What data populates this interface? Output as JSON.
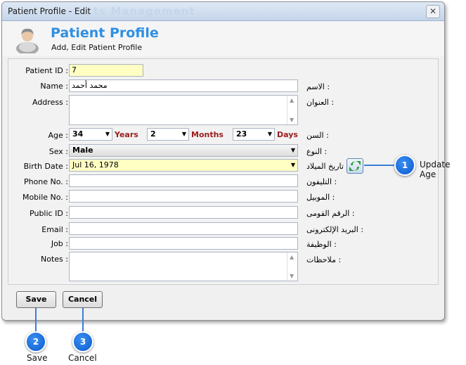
{
  "window": {
    "title": "Patient Profile - Edit",
    "ghost_text": "ts Management",
    "close_glyph": "✕"
  },
  "header": {
    "title": "Patient Profile",
    "subtitle": "Add, Edit Patient Profile",
    "avatar_icon": "patient-avatar-icon"
  },
  "form": {
    "patient_id": {
      "label": "Patient ID :",
      "value": "7"
    },
    "name": {
      "label": "Name :",
      "value": "محمد أحمد",
      "ar_label": "الاسم :"
    },
    "address": {
      "label": "Address :",
      "value": "",
      "ar_label": "العنوان :"
    },
    "age": {
      "label": "Age :",
      "ar_label": "السن :",
      "years_value": "34",
      "years_unit": "Years",
      "months_value": "2",
      "months_unit": "Months",
      "days_value": "23",
      "days_unit": "Days"
    },
    "sex": {
      "label": "Sex :",
      "value": "Male",
      "ar_label": "النوع :"
    },
    "birth_date": {
      "label": "Birth Date :",
      "value": "Jul 16, 1978",
      "ar_label": "تاريخ الميلاد :"
    },
    "phone": {
      "label": "Phone No. :",
      "value": "",
      "ar_label": "التليفون :"
    },
    "mobile": {
      "label": "Mobile No. :",
      "value": "",
      "ar_label": "الموبيل :"
    },
    "public_id": {
      "label": "Public ID :",
      "value": "",
      "ar_label": "الرقم القومى :"
    },
    "email": {
      "label": "Email :",
      "value": "",
      "ar_label": "البريد الإلكترونى :"
    },
    "job": {
      "label": "Job :",
      "value": "",
      "ar_label": "الوظيفة :"
    },
    "notes": {
      "label": "Notes :",
      "value": "",
      "ar_label": "ملاحظات :"
    }
  },
  "buttons": {
    "save": "Save",
    "cancel": "Cancel"
  },
  "callouts": [
    {
      "number": "1",
      "label": "Update Age"
    },
    {
      "number": "2",
      "label": "Save"
    },
    {
      "number": "3",
      "label": "Cancel"
    }
  ],
  "colors": {
    "title_blue": "#2e8fe2",
    "unit_red": "#9b1c1c",
    "callout_blue": "#0b5bd1",
    "highlight_yellow": "#ffffc4"
  }
}
